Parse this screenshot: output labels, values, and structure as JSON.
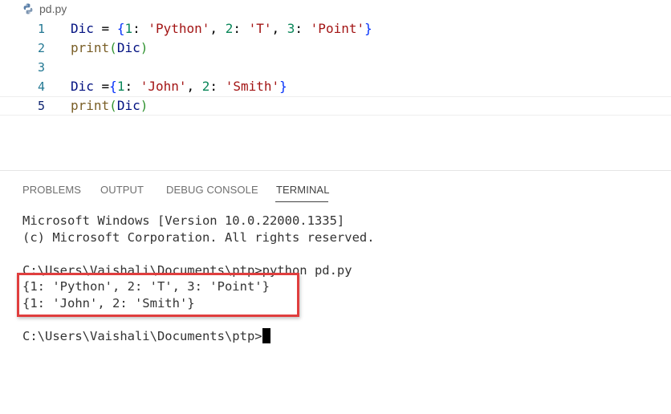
{
  "editor": {
    "file_name": "pd.py",
    "file_icon": "python-icon",
    "lines": [
      {
        "number": "1",
        "tokens": [
          {
            "t": "Dic",
            "c": "name"
          },
          {
            "t": " = ",
            "c": "op"
          },
          {
            "t": "{",
            "c": "brace"
          },
          {
            "t": "1",
            "c": "num"
          },
          {
            "t": ": ",
            "c": "op"
          },
          {
            "t": "'Python'",
            "c": "str"
          },
          {
            "t": ", ",
            "c": "op"
          },
          {
            "t": "2",
            "c": "num"
          },
          {
            "t": ": ",
            "c": "op"
          },
          {
            "t": "'T'",
            "c": "str"
          },
          {
            "t": ", ",
            "c": "op"
          },
          {
            "t": "3",
            "c": "num"
          },
          {
            "t": ": ",
            "c": "op"
          },
          {
            "t": "'Point'",
            "c": "str"
          },
          {
            "t": "}",
            "c": "brace"
          }
        ]
      },
      {
        "number": "2",
        "tokens": [
          {
            "t": "print",
            "c": "func"
          },
          {
            "t": "(",
            "c": "paren"
          },
          {
            "t": "Dic",
            "c": "name"
          },
          {
            "t": ")",
            "c": "paren"
          }
        ]
      },
      {
        "number": "3",
        "tokens": []
      },
      {
        "number": "4",
        "tokens": [
          {
            "t": "Dic",
            "c": "name"
          },
          {
            "t": " =",
            "c": "op"
          },
          {
            "t": "{",
            "c": "brace"
          },
          {
            "t": "1",
            "c": "num"
          },
          {
            "t": ": ",
            "c": "op"
          },
          {
            "t": "'John'",
            "c": "str"
          },
          {
            "t": ", ",
            "c": "op"
          },
          {
            "t": "2",
            "c": "num"
          },
          {
            "t": ": ",
            "c": "op"
          },
          {
            "t": "'Smith'",
            "c": "str"
          },
          {
            "t": "}",
            "c": "brace"
          }
        ]
      },
      {
        "number": "5",
        "active": true,
        "tokens": [
          {
            "t": "print",
            "c": "func"
          },
          {
            "t": "(",
            "c": "paren"
          },
          {
            "t": "Dic",
            "c": "name"
          },
          {
            "t": ")",
            "c": "paren"
          }
        ]
      }
    ]
  },
  "panel": {
    "tabs": [
      "PROBLEMS",
      "OUTPUT",
      "DEBUG CONSOLE",
      "TERMINAL"
    ],
    "active_tab": "TERMINAL"
  },
  "terminal": {
    "lines": [
      "Microsoft Windows [Version 10.0.22000.1335]",
      "(c) Microsoft Corporation. All rights reserved.",
      "",
      "C:\\Users\\Vaishali\\Documents\\ptp>python pd.py",
      "{1: 'Python', 2: 'T', 3: 'Point'}",
      "{1: 'John', 2: 'Smith'}",
      "",
      "C:\\Users\\Vaishali\\Documents\\ptp>"
    ]
  },
  "colors": {
    "highlight_box": "#e03e3e",
    "line_number": "#237893",
    "string": "#a31515",
    "number": "#098658"
  }
}
